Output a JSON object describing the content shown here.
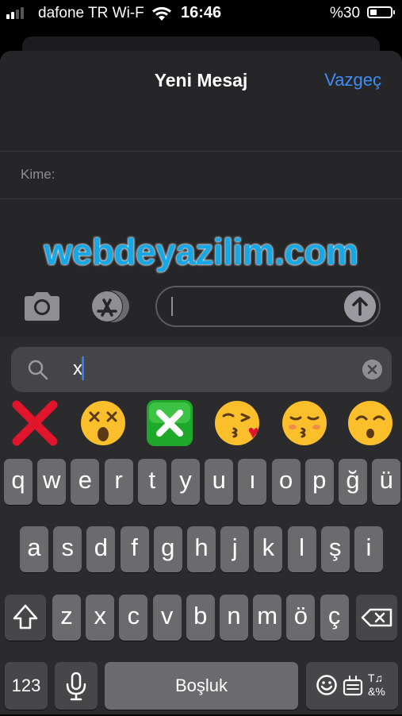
{
  "status_bar": {
    "carrier": "dafone TR Wi-F",
    "time": "16:46",
    "battery_text": "%30",
    "battery_level": 0.3
  },
  "sheet": {
    "title": "Yeni Mesaj",
    "cancel_label": "Vazgeç",
    "to_label": "Kime:"
  },
  "watermark": "webdeyazilim.com",
  "message_field": {
    "value": "",
    "placeholder": ""
  },
  "icons": {
    "camera": "camera-icon",
    "app_store": "app-store-icon",
    "send": "send-arrow-icon",
    "search": "search-icon",
    "clear": "clear-icon",
    "shift": "shift-icon",
    "delete": "delete-icon",
    "mic": "microphone-icon",
    "emoji_switch": "emoji-icon",
    "symbols": "symbols-icon"
  },
  "emoji_search": {
    "query": "x"
  },
  "emoji_results": [
    {
      "name": "cross-mark",
      "char": "❌"
    },
    {
      "name": "dizzy-face",
      "char": "😵"
    },
    {
      "name": "cross-mark-button",
      "char": "❎"
    },
    {
      "name": "face-blowing-kiss",
      "char": "😘"
    },
    {
      "name": "kissing-face-closed-eyes",
      "char": "😚"
    },
    {
      "name": "kissing-face-smiling-eyes",
      "char": "😙"
    }
  ],
  "keyboard": {
    "row1": [
      "q",
      "w",
      "e",
      "r",
      "t",
      "y",
      "u",
      "ı",
      "o",
      "p",
      "ğ",
      "ü"
    ],
    "row2": [
      "a",
      "s",
      "d",
      "f",
      "g",
      "h",
      "j",
      "k",
      "l",
      "ş",
      "i"
    ],
    "row3": [
      "z",
      "x",
      "c",
      "v",
      "b",
      "n",
      "m",
      "ö",
      "ç"
    ],
    "numbers_label": "123",
    "space_label": "Boşluk",
    "symbols_label": "T♫ &%"
  },
  "colors": {
    "accent": "#3d8ef7",
    "watermark": "#16a8e6",
    "caret": "#2f7cf6"
  }
}
